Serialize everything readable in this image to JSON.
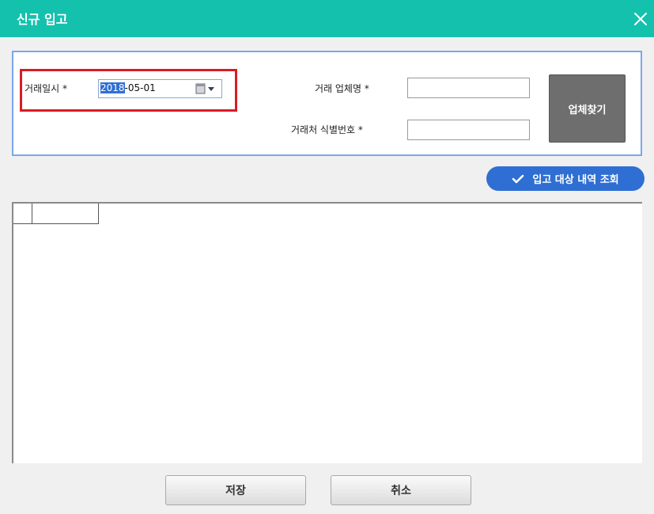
{
  "dialog": {
    "title": "신규 입고"
  },
  "form": {
    "date_label": "거래일시 *",
    "date_value_selected": "2018",
    "date_value_rest": "-05-01",
    "vendor_name_label": "거래 업체명 *",
    "vendor_name_value": "",
    "vendor_id_label": "거래처 식별번호 *",
    "vendor_id_value": "",
    "find_vendor_button": "업체찾기"
  },
  "actions": {
    "query_button": "입고 대상 내역 조회",
    "save_button": "저장",
    "cancel_button": "취소"
  },
  "grid": {
    "columns": [
      "",
      ""
    ],
    "rows": []
  },
  "colors": {
    "title_bar": "#14c1ad",
    "panel_border": "#7aa7ec",
    "highlight_border": "#d81c24",
    "primary_blue": "#2f6fd3",
    "find_button": "#6e6e6e"
  },
  "icons": {
    "close": "close-icon",
    "calendar": "calendar-icon",
    "dropdown": "chevron-down-icon",
    "check": "check-icon"
  }
}
